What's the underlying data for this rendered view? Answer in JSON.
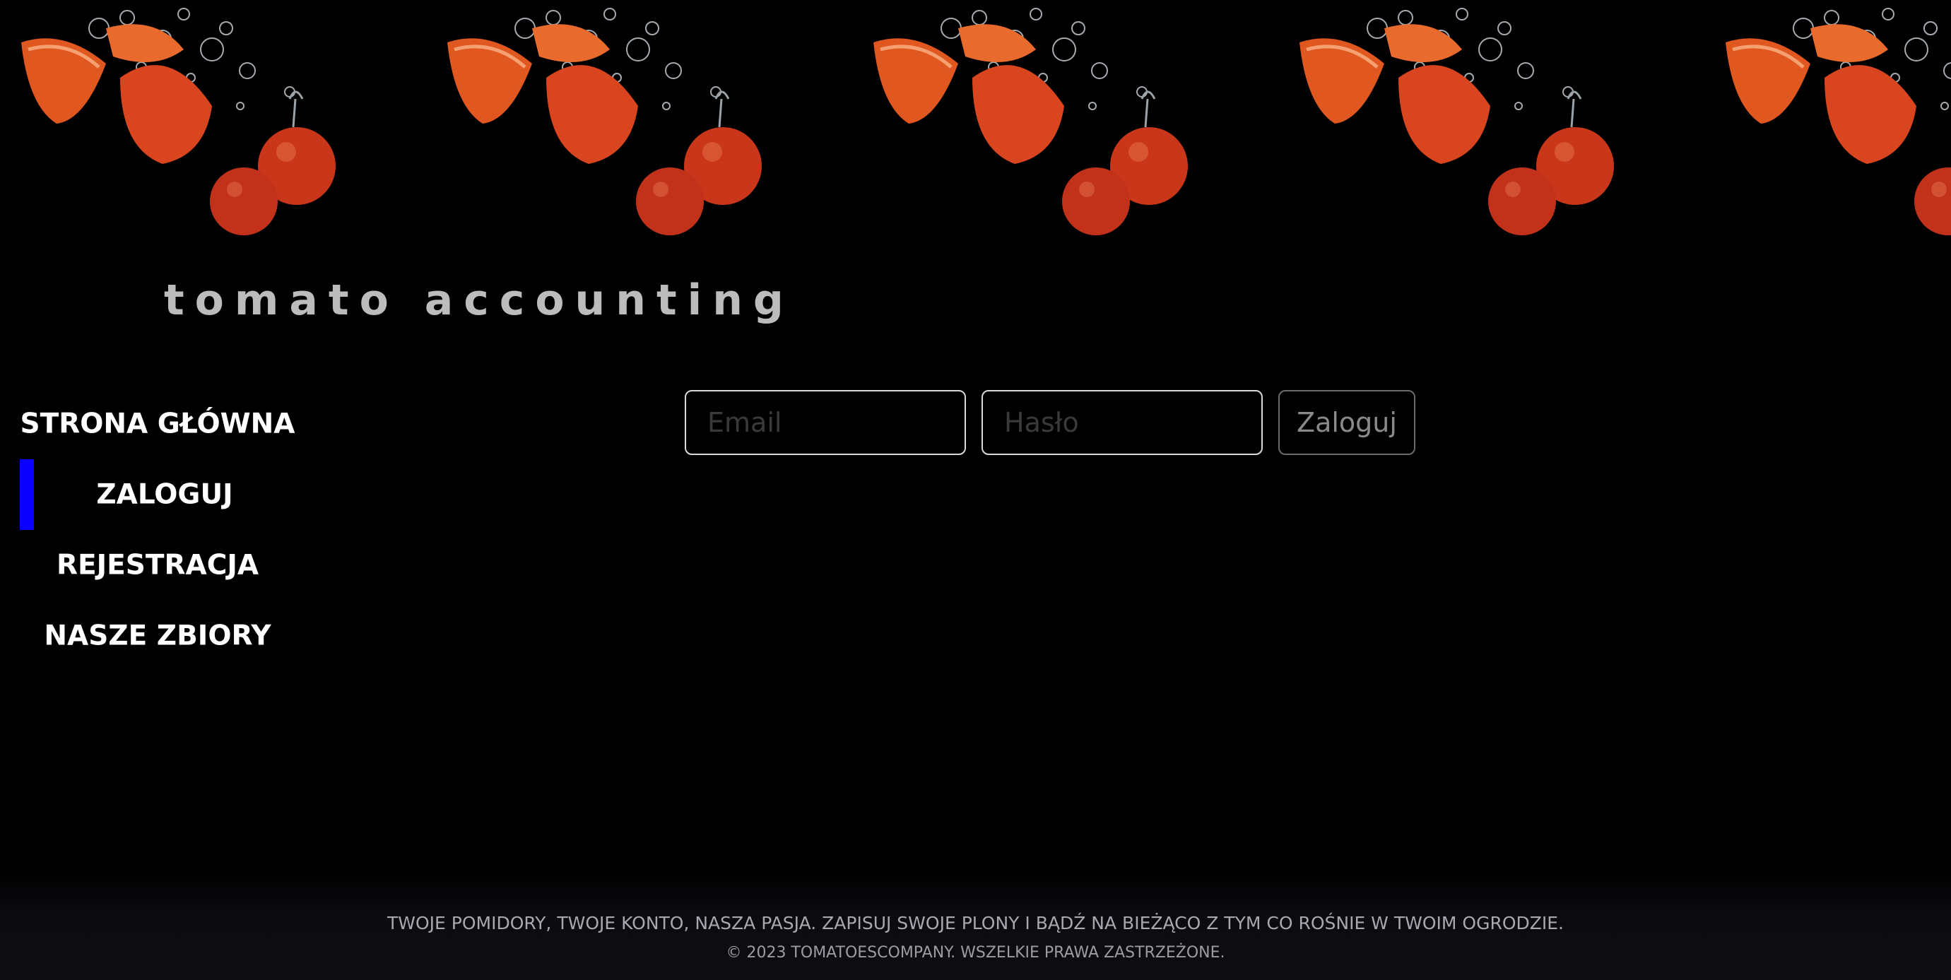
{
  "brand": {
    "title": "tomato accounting"
  },
  "banner": {
    "image": "tomatoes-splashing-in-water",
    "tile_count": 5
  },
  "nav": {
    "items": [
      {
        "label": "STRONA GŁÓWNA",
        "active": false
      },
      {
        "label": "ZALOGUJ",
        "active": true
      },
      {
        "label": "REJESTRACJA",
        "active": false
      },
      {
        "label": "NASZE ZBIORY",
        "active": false
      }
    ]
  },
  "login": {
    "email_placeholder": "Email",
    "email_value": "",
    "password_placeholder": "Hasło",
    "password_value": "",
    "submit_label": "Zaloguj"
  },
  "footer": {
    "tagline": "TWOJE POMIDORY, TWOJE KONTO, NASZA PASJA. ZAPISUJ SWOJE PLONY I BĄDŹ NA BIEŻĄCO Z TYM CO ROŚNIE W TWOIM OGRODZIE.",
    "copyright": "© 2023 TOMATOESCOMPANY. WSZELKIE PRAWA ZASTRZEŻONE."
  },
  "colors": {
    "background": "#000000",
    "accent_active_bar": "#0a00ff",
    "nav_text": "#ffffff",
    "brand_text": "#bcbcbc",
    "footer_text": "#a8a8b0",
    "tomato": "#d8451f"
  }
}
